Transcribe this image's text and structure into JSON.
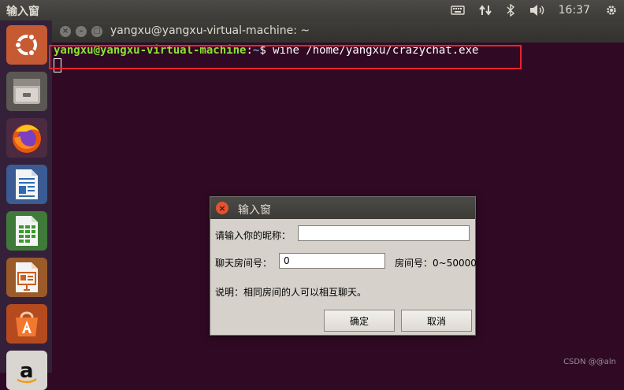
{
  "topbar": {
    "app_title": "输入窗",
    "clock": "16:37",
    "icons": [
      "keyboard-icon",
      "network-icon",
      "bluetooth-icon",
      "volume-icon",
      "power-gear-icon"
    ]
  },
  "launcher": {
    "items": [
      "ubuntu-dash-icon",
      "files-icon",
      "firefox-icon",
      "libreoffice-writer-icon",
      "libreoffice-calc-icon",
      "libreoffice-impress-icon",
      "software-center-icon",
      "amazon-icon"
    ]
  },
  "terminal": {
    "title": "yangxu@yangxu-virtual-machine: ~",
    "prompt_user": "yangxu@yangxu-virtual-machine",
    "prompt_sep": ":",
    "prompt_path": "~",
    "prompt_symbol": "$ ",
    "command": "wine /home/yangxu/crazychat.exe"
  },
  "dialog": {
    "title": "输入窗",
    "nickname_label": "请输入你的昵称：",
    "nickname_value": "",
    "room_label": "聊天房间号：",
    "room_value": "0",
    "room_range": "房间号：0~50000",
    "note": "说明：相同房间的人可以相互聊天。",
    "ok_label": "确定",
    "cancel_label": "取消"
  },
  "watermark": "CSDN @@aln",
  "colors": {
    "terminal_bg": "#300a24",
    "prompt_user": "#8ae234",
    "prompt_path": "#729fcf",
    "highlight_box": "#e8242f",
    "dialog_bg": "#d6d2cb"
  }
}
